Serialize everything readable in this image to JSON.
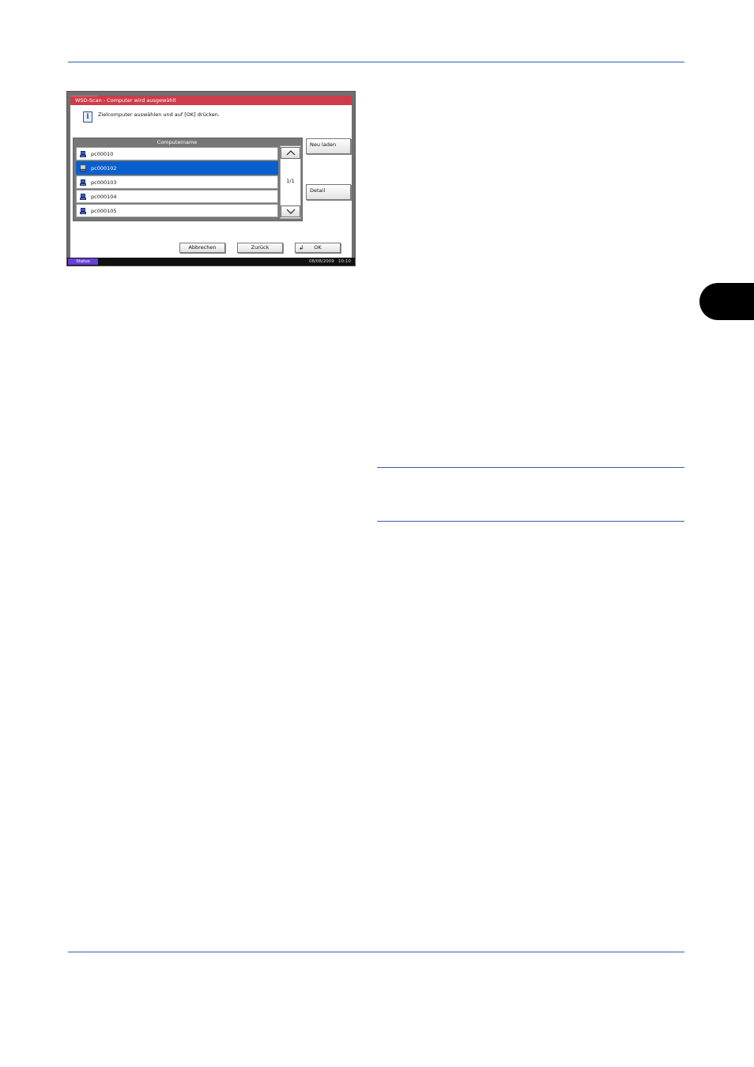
{
  "window": {
    "title": "WSD-Scan - Computer wird ausgewählt"
  },
  "message": "Zielcomputer auswählen und auf [OK] drücken.",
  "list": {
    "header": "Computername",
    "items": [
      {
        "label": "pc00010",
        "selected": false
      },
      {
        "label": "pc000102",
        "selected": true
      },
      {
        "label": "pc000103",
        "selected": false
      },
      {
        "label": "pc000104",
        "selected": false
      },
      {
        "label": "pc000105",
        "selected": false
      }
    ],
    "page_indicator": "1/1"
  },
  "side_buttons": {
    "reload_label": "Neu laden",
    "detail_label": "Detail"
  },
  "bottom_buttons": {
    "cancel_label": "Abbrechen",
    "back_label": "Zurück",
    "ok_label": "OK"
  },
  "status_bar": {
    "status_label": "Status",
    "date": "08/08/2009",
    "time": "10:10"
  },
  "colors": {
    "title_bar": "#cf3b4a",
    "selected_row": "#0a5fce",
    "status_button": "#6a3fd6",
    "page_rule": "#2a5fb0",
    "chapter_tab": "#000000"
  },
  "icons": {
    "info": "info-icon",
    "computer": "computer-icon",
    "scroll_up": "chevron-up-icon",
    "scroll_down": "chevron-down-icon",
    "enter": "enter-icon"
  }
}
